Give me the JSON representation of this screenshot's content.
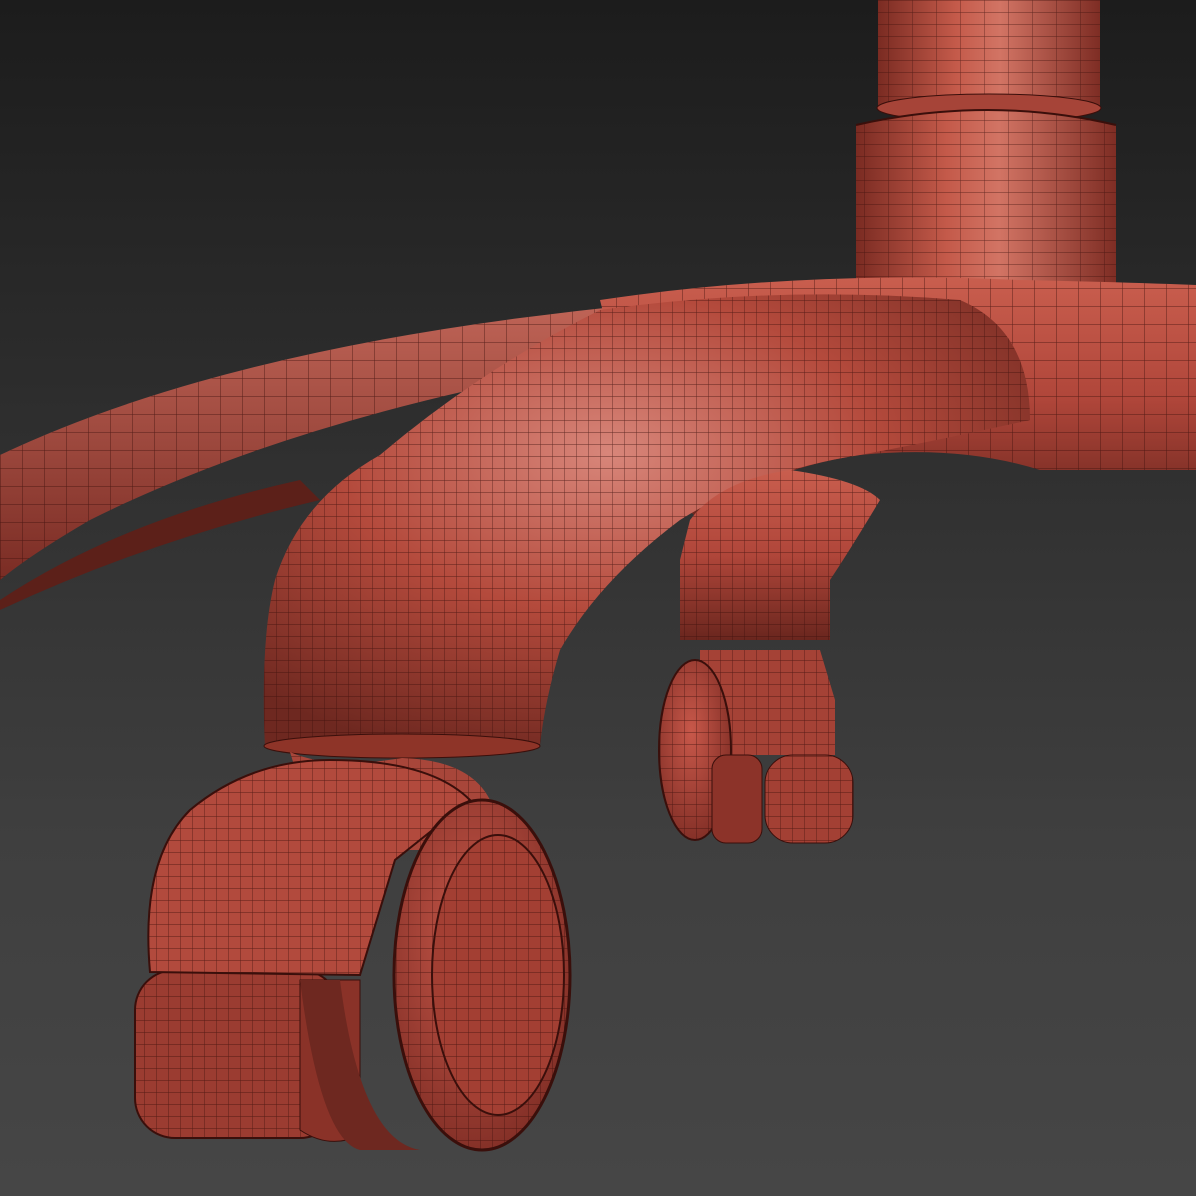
{
  "scene": {
    "subject": "chair-base-caster-wireframe",
    "colors": {
      "background_top": "#1c1c1c",
      "background_bottom": "#464646",
      "surface": "#b5483a",
      "surface_highlight": "#cf6a5a",
      "surface_shadow": "#6e2820",
      "wire": "#3a0f0b"
    }
  }
}
